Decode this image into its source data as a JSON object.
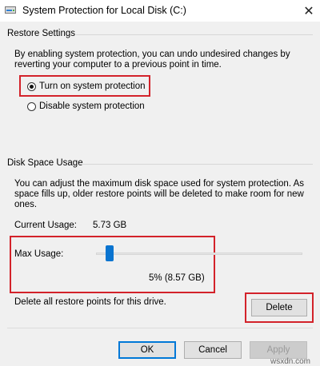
{
  "window": {
    "title": "System Protection for Local Disk (C:)",
    "close_label": "✕"
  },
  "restore_settings": {
    "group_label": "Restore Settings",
    "description_line1": "By enabling system protection, you can undo undesired changes by",
    "description_line2": "reverting your computer to a previous point in time.",
    "options": [
      {
        "label": "Turn on system protection",
        "selected": true
      },
      {
        "label": "Disable system protection",
        "selected": false
      }
    ]
  },
  "disk_space": {
    "group_label": "Disk Space Usage",
    "description_line1": "You can adjust the maximum disk space used for system protection. As",
    "description_line2": "space fills up, older restore points will be deleted to make room for new",
    "description_line3": "ones.",
    "current_usage_label": "Current Usage:",
    "current_usage_value": "5.73 GB",
    "max_usage_label": "Max Usage:",
    "max_usage_percent": 5,
    "max_usage_value": "5% (8.57 GB)",
    "delete_text": "Delete all restore points for this drive.",
    "delete_button": "Delete"
  },
  "buttons": {
    "ok": "OK",
    "cancel": "Cancel",
    "apply": "Apply"
  },
  "watermark": "wsxdn.com",
  "colors": {
    "highlight": "#d3222a",
    "accent": "#0a74d0"
  }
}
